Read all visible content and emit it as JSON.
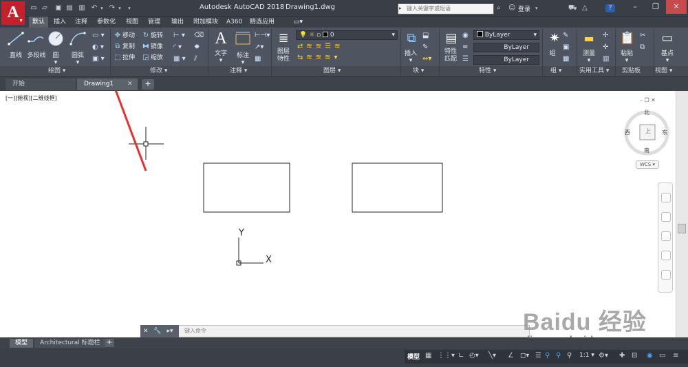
{
  "titlebar": {
    "app_letter": "A",
    "app_title": "Autodesk AutoCAD 2018",
    "doc_title": "Drawing1.dwg",
    "search_placeholder": "键入关键字或短语",
    "login_label": "登录"
  },
  "ribbon_tabs": [
    "默认",
    "插入",
    "注释",
    "参数化",
    "视图",
    "管理",
    "输出",
    "附加模块",
    "A360",
    "精选应用"
  ],
  "ribbon": {
    "draw": {
      "buttons": [
        "直线",
        "多段线",
        "圆",
        "圆弧"
      ],
      "panel_label": "绘图"
    },
    "modify": {
      "rows": [
        [
          "移动",
          "旋转"
        ],
        [
          "复制",
          "镜像"
        ],
        [
          "拉伸",
          "缩放"
        ]
      ],
      "panel_label": "修改"
    },
    "annotation": {
      "buttons": [
        "文字",
        "标注"
      ],
      "panel_label": "注释"
    },
    "layers": {
      "big_button": "图层\n特性",
      "current_layer": "0",
      "panel_label": "图层"
    },
    "block": {
      "button": "插入",
      "panel_label": "块"
    },
    "properties": {
      "big_button": "特性\n匹配",
      "color": "ByLayer",
      "linetype": "ByLayer",
      "lineweight": "ByLayer",
      "panel_label": "特性"
    },
    "groups": {
      "button": "组",
      "panel_label": "组"
    },
    "utilities": {
      "button": "测量",
      "panel_label": "实用工具"
    },
    "clipboard": {
      "button": "粘贴",
      "panel_label": "剪贴板"
    },
    "view": {
      "button": "基点",
      "panel_label": "视图"
    }
  },
  "doc_tabs": {
    "start": "开始",
    "drawing": "Drawing1"
  },
  "canvas": {
    "viewport_label": "[一][俯视][二维线框]",
    "viewcube": {
      "north": "北",
      "south": "南",
      "east": "东",
      "west": "西",
      "top": "上",
      "wcs": "WCS"
    },
    "ucs": {
      "x": "X",
      "y": "Y"
    }
  },
  "command_line": {
    "placeholder": "键入命令"
  },
  "bottom_tabs": {
    "model": "模型",
    "layout": "Architectural 标题栏"
  },
  "status": {
    "model": "模型",
    "scale": "1:1"
  },
  "watermark": {
    "main": "Baidu 经验",
    "sub": "jingyan.baidu.com"
  },
  "colors": {
    "app_red": "#c8202a",
    "ribbon_bg": "#4f5560",
    "accent_blue": "#46a3ff",
    "arrow_red": "#e8302e"
  }
}
